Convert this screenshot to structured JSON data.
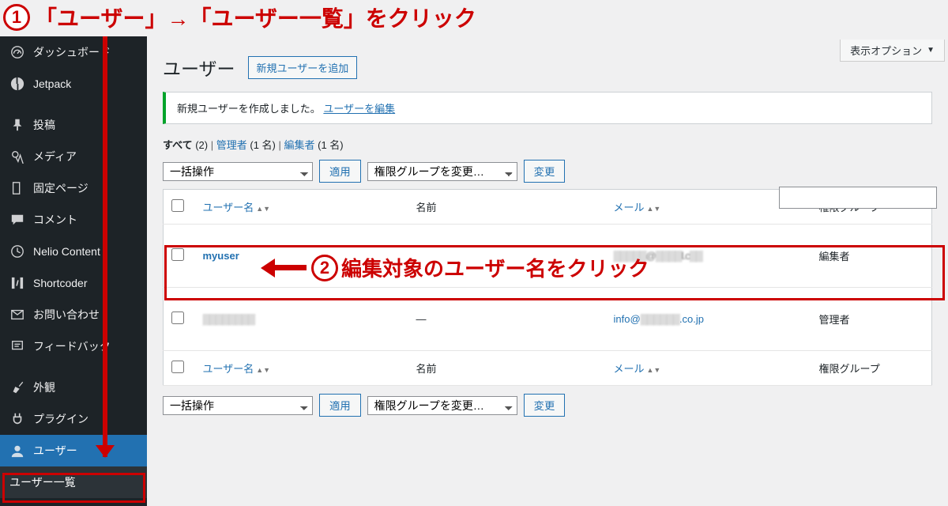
{
  "annotations": {
    "step1_num": "1",
    "step1_text": "「ユーザー」→「ユーザー一覧」をクリック",
    "step2_num": "2",
    "step2_text": "編集対象のユーザー名をクリック"
  },
  "screen_options": {
    "label": "表示オプション",
    "caret": "▼"
  },
  "sidebar": {
    "items": [
      {
        "label": "ダッシュボード"
      },
      {
        "label": "Jetpack"
      },
      {
        "label": "投稿"
      },
      {
        "label": "メディア"
      },
      {
        "label": "固定ページ"
      },
      {
        "label": "コメント"
      },
      {
        "label": "Nelio Content"
      },
      {
        "label": "Shortcoder"
      },
      {
        "label": "お問い合わせ"
      },
      {
        "label": "フィードバック"
      },
      {
        "label": "外観"
      },
      {
        "label": "プラグイン"
      },
      {
        "label": "ユーザー"
      }
    ],
    "submenu": {
      "label": "ユーザー一覧"
    }
  },
  "page": {
    "title": "ユーザー",
    "add_new": "新規ユーザーを追加"
  },
  "notice": {
    "text": "新規ユーザーを作成しました。",
    "link": "ユーザーを編集"
  },
  "subsub": {
    "all": "すべて",
    "all_count": "(2)",
    "admin": "管理者",
    "admin_count": "(1 名)",
    "editor": "編集者",
    "editor_count": "(1 名)"
  },
  "filters": {
    "bulk": "一括操作",
    "apply": "適用",
    "role_change": "権限グループを変更…",
    "change": "変更"
  },
  "table": {
    "col_user": "ユーザー名",
    "col_name": "名前",
    "col_email": "メール",
    "col_role": "権限グループ",
    "rows": [
      {
        "user": "myuser",
        "name_blur": "",
        "email_full_obscured": "▒▒▒▒▒@▒▒▒▒l.c▒▒",
        "role": "編集者"
      },
      {
        "user_blur": "▒▒▒▒▒▒▒▒",
        "name": "—",
        "email_pre": "info@",
        "email_obscured": "▒▒▒▒▒▒",
        "email_post": ".co.jp",
        "role": "管理者"
      }
    ]
  }
}
